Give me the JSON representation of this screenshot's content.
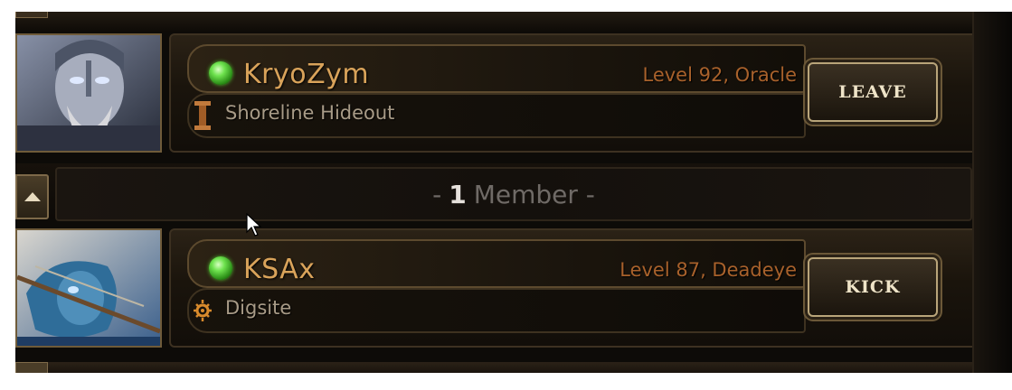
{
  "party": {
    "members": [
      {
        "name": "KryoZym",
        "level_class": "Level 92, Oracle",
        "zone": "Shoreline Hideout",
        "zone_icon": "hideout-pillar-icon",
        "status": "online",
        "action_label": "LEAVE"
      },
      {
        "name": "KSAx",
        "level_class": "Level 87, Deadeye",
        "zone": "Digsite",
        "zone_icon": "waypoint-sun-icon",
        "status": "online",
        "action_label": "KICK"
      }
    ],
    "divider": {
      "prefix": "-",
      "count": "1",
      "label": "Member -"
    }
  },
  "colors": {
    "name": "#d9a35a",
    "level": "#a8612b",
    "zone": "#a89b87",
    "online": "#4fbf2e"
  }
}
